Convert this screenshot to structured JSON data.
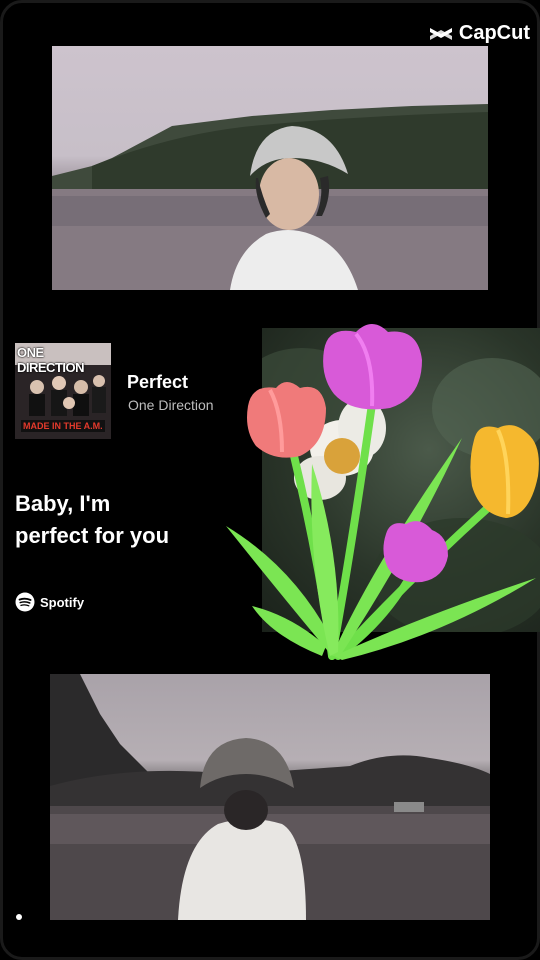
{
  "watermark": {
    "brand": "CapCut",
    "icon": "capcut-logo-icon"
  },
  "album": {
    "band_text": "ONE DIRECTION",
    "album_text": "MADE IN THE A.M."
  },
  "track": {
    "title": "Perfect",
    "artist": "One Direction"
  },
  "lyrics": {
    "line1": "Baby, I'm",
    "line2": "perfect for you"
  },
  "spotify": {
    "label": "Spotify",
    "icon": "spotify-logo-icon"
  },
  "colors": {
    "background": "#000000",
    "tulip_pink": "#f07a7a",
    "tulip_magenta": "#d85ad8",
    "tulip_yellow": "#f5b82e",
    "stem_green": "#6fe04a"
  }
}
